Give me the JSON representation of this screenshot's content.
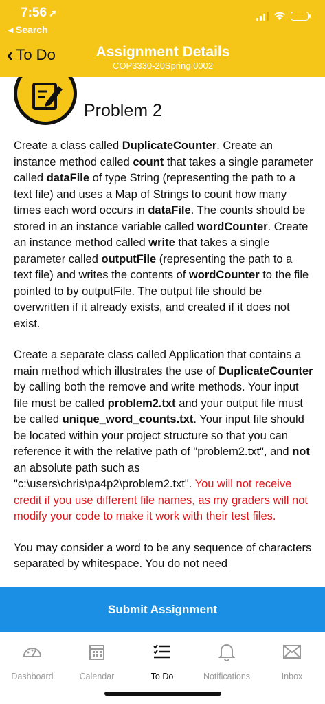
{
  "status_bar": {
    "time": "7:56",
    "back_app": "◂ Search"
  },
  "nav": {
    "back_label": "To Do",
    "title": "Assignment Details",
    "subtitle": "COP3330-20Spring 0002"
  },
  "problem": {
    "title": "Problem 2",
    "p1": [
      {
        "t": "Create a class called ",
        "b": false
      },
      {
        "t": "DuplicateCounter",
        "b": true
      },
      {
        "t": ". Create an instance method called ",
        "b": false
      },
      {
        "t": "count",
        "b": true
      },
      {
        "t": " that takes a single parameter called ",
        "b": false
      },
      {
        "t": "dataFile",
        "b": true
      },
      {
        "t": " of type String (representing the path to a text file) and uses a Map of Strings to count how many times each word occurs in ",
        "b": false
      },
      {
        "t": "dataFile",
        "b": true
      },
      {
        "t": ". The counts should be stored in an instance variable called ",
        "b": false
      },
      {
        "t": "wordCounter",
        "b": true
      },
      {
        "t": ". Create an instance method called ",
        "b": false
      },
      {
        "t": "write",
        "b": true
      },
      {
        "t": " that takes a single parameter called ",
        "b": false
      },
      {
        "t": "outputFile",
        "b": true
      },
      {
        "t": " (representing the path to a text file) and writes the contents of ",
        "b": false
      },
      {
        "t": "wordCounter",
        "b": true
      },
      {
        "t": " to the file pointed to by outputFile. The output file should be overwritten if it already exists, and created if it does not exist.",
        "b": false
      }
    ],
    "p2": [
      {
        "t": "Create a separate class called Application that contains a main method which illustrates the use of ",
        "b": false
      },
      {
        "t": "DuplicateCounter",
        "b": true
      },
      {
        "t": " by calling both the remove and write methods. Your input file must be called ",
        "b": false
      },
      {
        "t": "problem2.txt",
        "b": true
      },
      {
        "t": " and your output file must be called ",
        "b": false
      },
      {
        "t": "unique_word_counts.txt",
        "b": true
      },
      {
        "t": ". Your input file should be located within your project structure so that you can reference it with the relative path of \"problem2.txt\", and ",
        "b": false
      },
      {
        "t": "not",
        "b": true
      },
      {
        "t": " an absolute path such as \"c:\\users\\chris\\pa4p2\\problem2.txt\". ",
        "b": false
      },
      {
        "t": "You will not receive credit if you use different file names, as my graders will not modify your code to make it work with their test files.",
        "b": false,
        "red": true
      }
    ],
    "p3": "You may consider a word to be any sequence of characters separated by whitespace. You do not need"
  },
  "submit_label": "Submit Assignment",
  "tabs": [
    {
      "label": "Dashboard",
      "icon": "dashboard-icon",
      "active": false
    },
    {
      "label": "Calendar",
      "icon": "calendar-icon",
      "active": false
    },
    {
      "label": "To Do",
      "icon": "todo-icon",
      "active": true
    },
    {
      "label": "Notifications",
      "icon": "bell-icon",
      "active": false
    },
    {
      "label": "Inbox",
      "icon": "inbox-icon",
      "active": false
    }
  ],
  "colors": {
    "header": "#F5C518",
    "submit": "#1A8FE3",
    "warning_text": "#E0141A"
  }
}
